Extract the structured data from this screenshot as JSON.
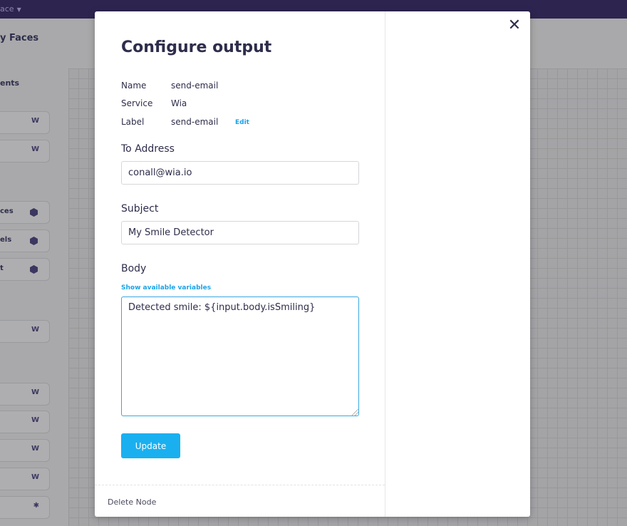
{
  "background": {
    "workspace_label": "ace",
    "flow_name": "y Faces",
    "sidebar_heading": "ents",
    "sidebar_items": [
      {
        "label": "",
        "icon": "W"
      },
      {
        "label": "",
        "icon": "W"
      },
      {
        "label": "ces",
        "icon": "hex-icon"
      },
      {
        "label": "els",
        "icon": "hex-icon"
      },
      {
        "label": "t",
        "icon": "hex-icon"
      },
      {
        "label": "",
        "icon": "W"
      },
      {
        "label": "",
        "icon": "W"
      },
      {
        "label": "",
        "icon": "W"
      },
      {
        "label": "",
        "icon": "W"
      },
      {
        "label": "",
        "icon": "W"
      },
      {
        "label": "",
        "icon": "✱"
      }
    ]
  },
  "modal": {
    "close_icon": "✕",
    "title": "Configure output",
    "meta": {
      "name_label": "Name",
      "name_value": "send-email",
      "service_label": "Service",
      "service_value": "Wia",
      "label_label": "Label",
      "label_value": "send-email",
      "edit_link": "Edit"
    },
    "to_address": {
      "label": "To Address",
      "value": "conall@wia.io"
    },
    "subject": {
      "label": "Subject",
      "value": "My Smile Detector"
    },
    "body": {
      "label": "Body",
      "variables_link": "Show available variables",
      "value": "Detected smile: ${input.body.isSmiling}"
    },
    "update_button": "Update",
    "delete_node": "Delete Node"
  },
  "colors": {
    "primary_text": "#2e2d4b",
    "link": "#1aa3e8",
    "button": "#1ab0f0",
    "topbar": "#2d2450"
  }
}
